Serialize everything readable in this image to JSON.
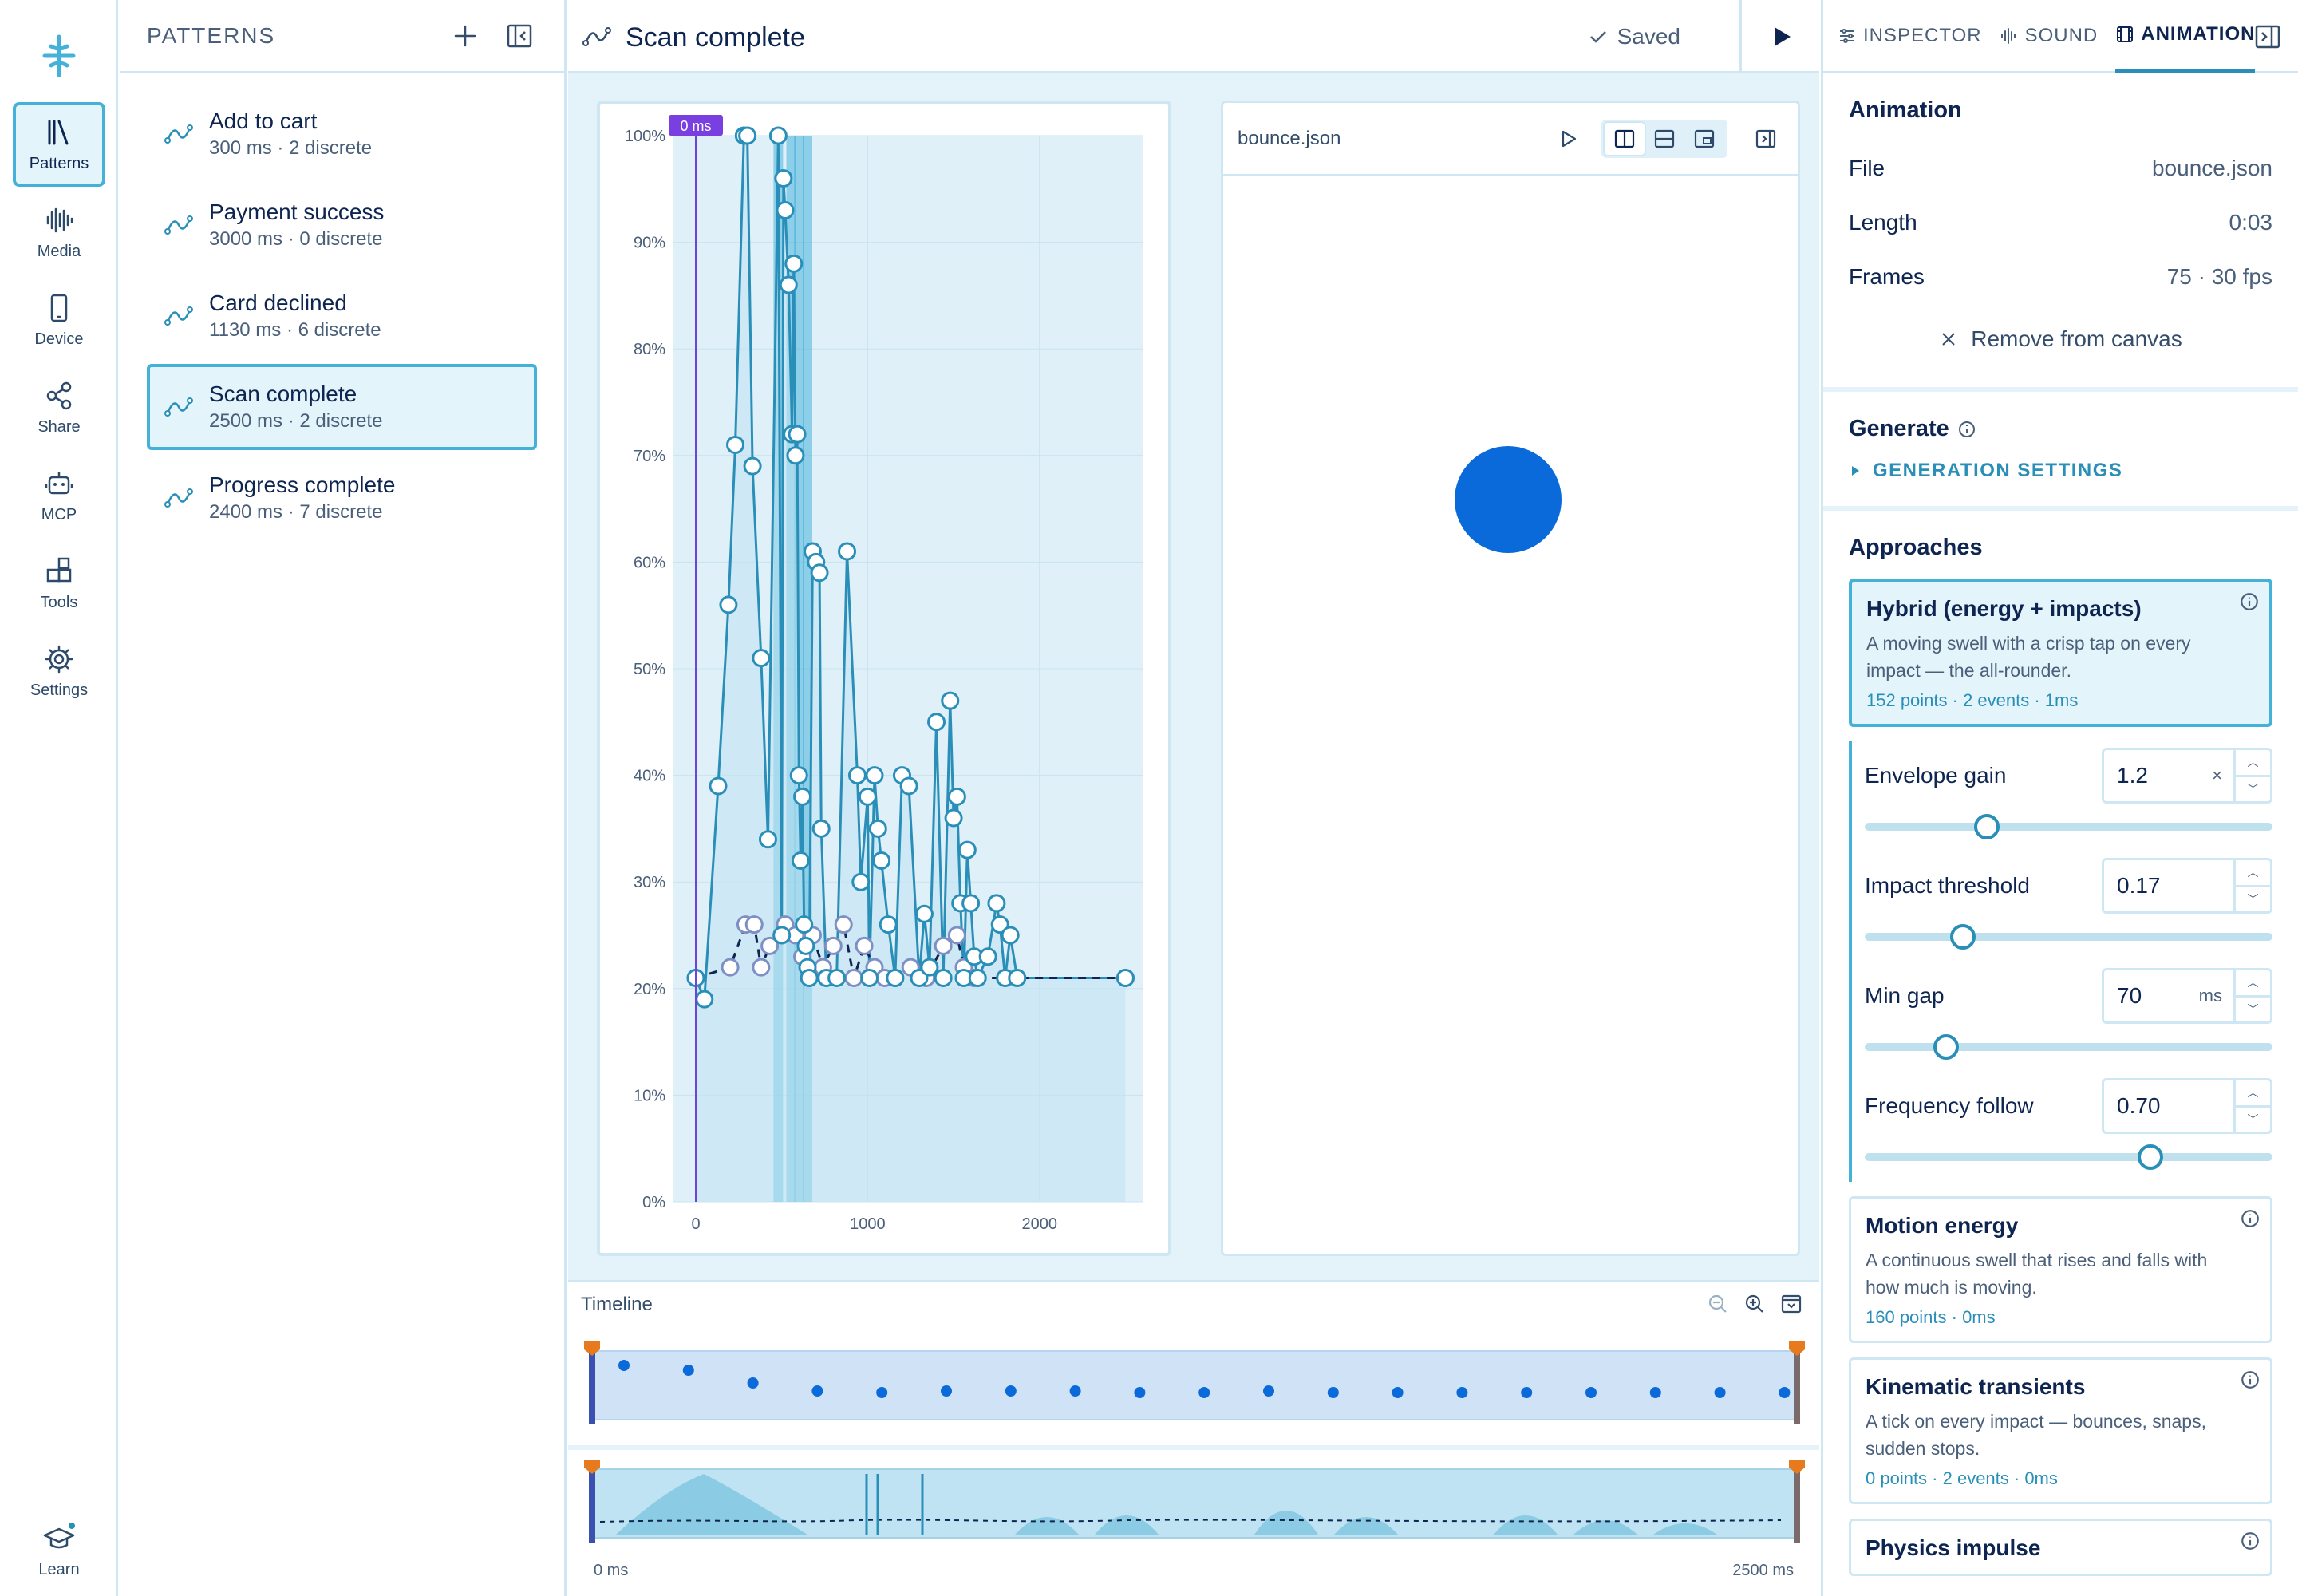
{
  "rail": {
    "items": [
      {
        "label": "Patterns",
        "icon": "library-icon"
      },
      {
        "label": "Media",
        "icon": "waveform-icon"
      },
      {
        "label": "Device",
        "icon": "phone-icon"
      },
      {
        "label": "Share",
        "icon": "share-icon"
      },
      {
        "label": "MCP",
        "icon": "robot-icon"
      },
      {
        "label": "Tools",
        "icon": "blocks-icon"
      },
      {
        "label": "Settings",
        "icon": "gear-icon"
      }
    ],
    "learn_label": "Learn"
  },
  "patterns": {
    "title": "PATTERNS",
    "items": [
      {
        "name": "Add to cart",
        "meta": "300 ms · 2 discrete"
      },
      {
        "name": "Payment success",
        "meta": "3000 ms · 0 discrete"
      },
      {
        "name": "Card declined",
        "meta": "1130 ms · 6 discrete"
      },
      {
        "name": "Scan complete",
        "meta": "2500 ms · 2 discrete"
      },
      {
        "name": "Progress complete",
        "meta": "2400 ms · 7 discrete"
      }
    ]
  },
  "editor": {
    "title": "Scan complete",
    "saved_label": "Saved",
    "playhead_label": "0 ms"
  },
  "preview": {
    "file": "bounce.json"
  },
  "timeline": {
    "title": "Timeline",
    "start_label": "0 ms",
    "end_label": "2500 ms"
  },
  "inspector": {
    "tabs": [
      {
        "label": "INSPECTOR",
        "icon": "sliders-icon"
      },
      {
        "label": "SOUND",
        "icon": "waveform-icon"
      },
      {
        "label": "ANIMATION",
        "icon": "film-icon"
      }
    ],
    "animation": {
      "heading": "Animation",
      "rows": [
        {
          "k": "File",
          "v": "bounce.json"
        },
        {
          "k": "Length",
          "v": "0:03"
        },
        {
          "k": "Frames",
          "v": "75 · 30 fps"
        }
      ],
      "remove_label": "Remove from canvas"
    },
    "generate": {
      "heading": "Generate",
      "settings_label": "GENERATION SETTINGS"
    },
    "approaches": {
      "heading": "Approaches",
      "items": [
        {
          "title": "Hybrid (energy + impacts)",
          "desc": "A moving swell with a crisp tap on every impact — the all-rounder.",
          "meta": "152 points · 2 events · 1ms"
        },
        {
          "title": "Motion energy",
          "desc": "A continuous swell that rises and falls with how much is moving.",
          "meta": "160 points · 0ms"
        },
        {
          "title": "Kinematic transients",
          "desc": "A tick on every impact — bounces, snaps, sudden stops.",
          "meta": "0 points · 2 events · 0ms"
        },
        {
          "title": "Physics impulse",
          "desc": "",
          "meta": ""
        }
      ],
      "params": [
        {
          "name": "Envelope gain",
          "value": "1.2",
          "unit": "×",
          "level": 0.3
        },
        {
          "name": "Impact threshold",
          "value": "0.17",
          "unit": "",
          "level": 0.24
        },
        {
          "name": "Min gap",
          "value": "70",
          "unit": "ms",
          "level": 0.2
        },
        {
          "name": "Frequency follow",
          "value": "0.70",
          "unit": "",
          "level": 0.7
        }
      ]
    }
  },
  "chart_data": {
    "type": "line",
    "x_ticks": [
      "0",
      "1000",
      "2000"
    ],
    "y_ticks": [
      "0%",
      "10%",
      "20%",
      "30%",
      "40%",
      "50%",
      "60%",
      "70%",
      "80%",
      "90%",
      "100%"
    ],
    "xlim": [
      0,
      2600
    ],
    "ylim": [
      0,
      100
    ],
    "series": [
      {
        "kind": "intensity",
        "x": [
          0,
          50,
          130,
          190,
          230,
          280,
          300,
          330,
          380,
          420,
          480,
          500,
          510,
          520,
          540,
          560,
          570,
          580,
          590,
          600,
          610,
          620,
          630,
          640,
          650,
          660,
          680,
          700,
          720,
          730,
          760,
          820,
          880,
          940,
          960,
          1000,
          1010,
          1040,
          1060,
          1080,
          1120,
          1160,
          1200,
          1240,
          1300,
          1330,
          1360,
          1400,
          1440,
          1480,
          1500,
          1520,
          1540,
          1560,
          1580,
          1600,
          1620,
          1640,
          1700,
          1750,
          1770,
          1800,
          1830,
          1870,
          2500
        ],
        "y": [
          21,
          19,
          39,
          56,
          71,
          100,
          100,
          69,
          51,
          34,
          100,
          25,
          96,
          93,
          86,
          72,
          88,
          70,
          72,
          40,
          32,
          38,
          26,
          24,
          22,
          21,
          61,
          60,
          59,
          35,
          21,
          21,
          61,
          40,
          30,
          38,
          21,
          40,
          35,
          32,
          26,
          21,
          40,
          39,
          21,
          27,
          22,
          45,
          21,
          47,
          36,
          38,
          28,
          21,
          33,
          28,
          23,
          21,
          23,
          28,
          26,
          21,
          25,
          21,
          21
        ]
      },
      {
        "kind": "sharpness",
        "x": [
          0,
          200,
          290,
          340,
          380,
          430,
          520,
          580,
          620,
          680,
          740,
          800,
          860,
          920,
          980,
          1040,
          1100,
          1160,
          1250,
          1340,
          1440,
          1520,
          1560,
          1620,
          2500
        ],
        "y": [
          21,
          22,
          26,
          26,
          22,
          24,
          26,
          25,
          23,
          25,
          22,
          24,
          26,
          21,
          24,
          22,
          21,
          21,
          22,
          21,
          24,
          25,
          22,
          21,
          21
        ]
      }
    ],
    "discrete_events_ms": [
      480,
      555,
      600,
      650
    ]
  }
}
